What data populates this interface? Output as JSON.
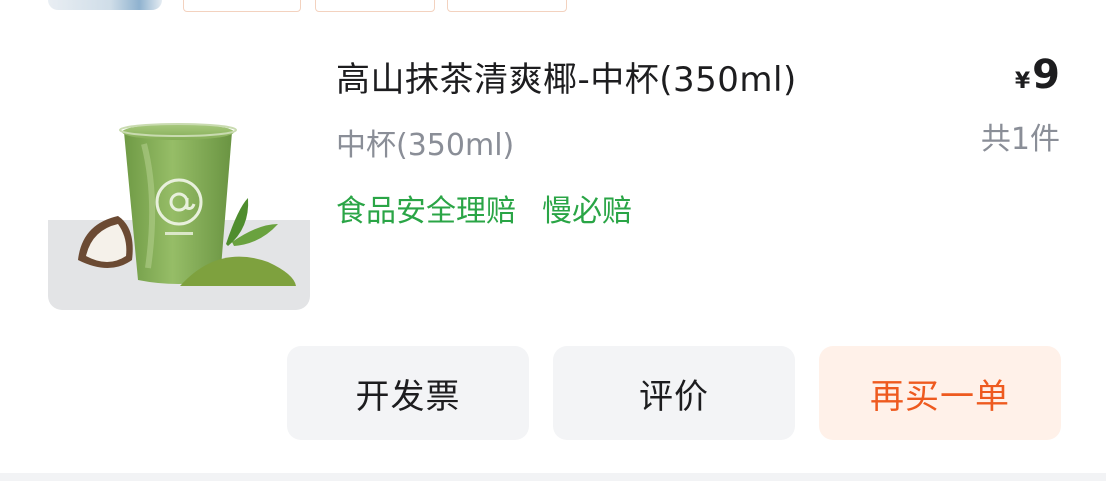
{
  "order_item": {
    "image_alt": "高山抹茶清爽椰-中杯(350ml)",
    "title": "高山抹茶清爽椰-中杯(350ml)",
    "spec": "中杯(350ml)",
    "tags": [
      "食品安全理赔",
      "慢必赔"
    ],
    "price_symbol": "¥",
    "price": "9",
    "quantity": "共1件"
  },
  "actions": {
    "invoice_label": "开发票",
    "review_label": "评价",
    "rebuy_label": "再买一单"
  },
  "colors": {
    "tag_green": "#2aa546",
    "rebuy_orange": "#ee5a1f",
    "rebuy_bg": "#fff1e9",
    "button_bg": "#f3f4f6",
    "muted_text": "#8a8e97"
  }
}
